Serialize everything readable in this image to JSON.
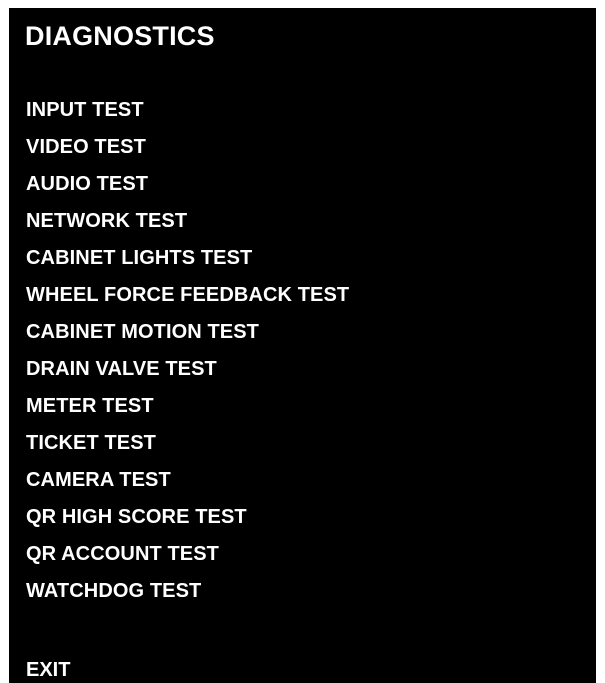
{
  "screen": {
    "title": "DIAGNOSTICS",
    "background_color": "#000000",
    "text_color": "#ffffff",
    "menu_items": [
      "INPUT TEST",
      "VIDEO TEST",
      "AUDIO TEST",
      "NETWORK TEST",
      "CABINET LIGHTS TEST",
      "WHEEL FORCE FEEDBACK TEST",
      "CABINET MOTION TEST",
      "DRAIN VALVE TEST",
      "METER TEST",
      "TICKET TEST",
      "CAMERA TEST",
      "QR HIGH SCORE TEST",
      "QR ACCOUNT TEST",
      "WATCHDOG TEST"
    ],
    "exit_label": "EXIT"
  }
}
